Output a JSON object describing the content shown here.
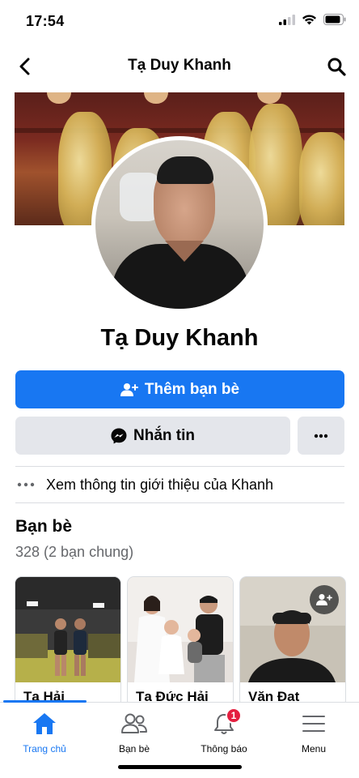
{
  "status": {
    "time": "17:54"
  },
  "nav": {
    "title": "Tạ Duy Khanh",
    "back_icon": "chevron-left-icon",
    "search_icon": "search-icon"
  },
  "profile": {
    "name": "Tạ Duy Khanh"
  },
  "actions": {
    "add_friend_label": "Thêm bạn bè",
    "message_label": "Nhắn tin",
    "more_label": "···"
  },
  "intro": {
    "dots": "•••",
    "text": "Xem thông tin giới thiệu của Khanh"
  },
  "friends": {
    "title": "Bạn bè",
    "count": "328 (2 bạn chung)",
    "items": [
      {
        "name": "Tạ Hải"
      },
      {
        "name": "Tạ Đức Hải"
      },
      {
        "name": "Văn Đạt"
      }
    ]
  },
  "tabs": [
    {
      "label": "Trang chủ",
      "icon": "home-icon",
      "active": true
    },
    {
      "label": "Bạn bè",
      "icon": "friends-icon",
      "active": false
    },
    {
      "label": "Thông báo",
      "icon": "bell-icon",
      "active": false,
      "badge": "1"
    },
    {
      "label": "Menu",
      "icon": "menu-icon",
      "active": false
    }
  ],
  "colors": {
    "accent": "#1877f2",
    "button_gray": "#e4e6eb",
    "badge_red": "#e41e3f",
    "text_secondary": "#65676b"
  }
}
